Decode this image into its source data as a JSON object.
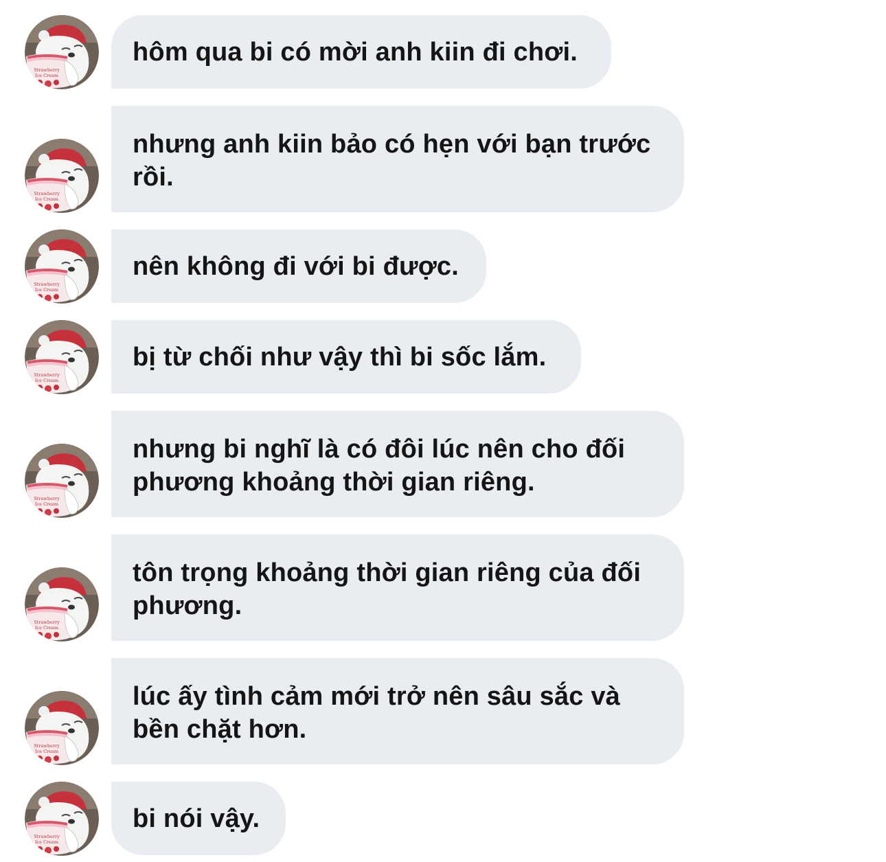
{
  "chat": {
    "bubble_color": "#e9edf1",
    "text_color": "#151515",
    "avatar": {
      "icon": "bear-ice-cream-avatar-icon",
      "cup_text": [
        "Strawberry",
        "Ice Cream"
      ]
    },
    "messages": [
      {
        "lines": [
          "hôm qua bi có mời anh kiin đi chơi."
        ]
      },
      {
        "lines": [
          "nhưng anh kiin bảo có hẹn với bạn trước",
          "rồi."
        ]
      },
      {
        "lines": [
          "nên không đi với bi được."
        ]
      },
      {
        "lines": [
          "bị từ chối như vậy thì bi sốc lắm."
        ]
      },
      {
        "lines": [
          "nhưng bi nghĩ là có đôi lúc nên cho đối",
          "phương khoảng thời gian riêng."
        ]
      },
      {
        "lines": [
          "tôn trọng khoảng thời gian riêng của đối",
          "phương."
        ]
      },
      {
        "lines": [
          "lúc ấy tình cảm mới trở nên sâu sắc và",
          "bền chặt hơn."
        ]
      },
      {
        "lines": [
          "bi nói vậy."
        ]
      }
    ]
  }
}
